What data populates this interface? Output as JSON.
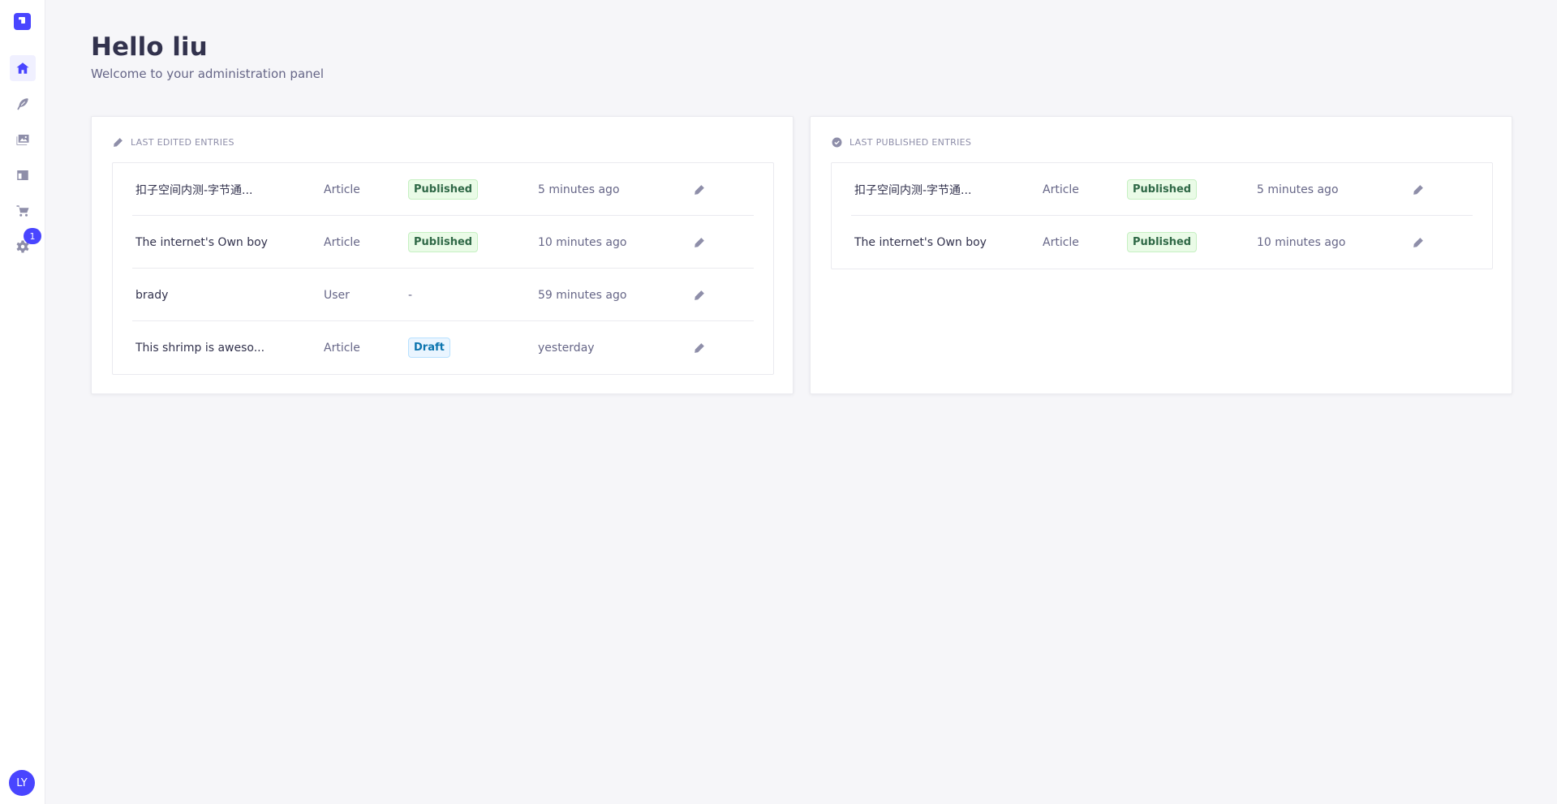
{
  "sidebar": {
    "items": [
      {
        "name": "home",
        "icon": "home-icon"
      },
      {
        "name": "content-manager",
        "icon": "feather-icon"
      },
      {
        "name": "media-library",
        "icon": "images-icon"
      },
      {
        "name": "content-type-builder",
        "icon": "layout-icon"
      },
      {
        "name": "marketplace",
        "icon": "cart-icon"
      },
      {
        "name": "settings",
        "icon": "gear-icon"
      }
    ],
    "settings_badge": "1",
    "avatar_initials": "LY"
  },
  "header": {
    "title": "Hello liu",
    "subtitle": "Welcome to your administration panel"
  },
  "last_edited": {
    "title": "LAST EDITED ENTRIES",
    "rows": [
      {
        "title": "扣子空间内测-字节通...",
        "type": "Article",
        "status": "Published",
        "time": "5 minutes ago"
      },
      {
        "title": "The internet's Own boy",
        "type": "Article",
        "status": "Published",
        "time": "10 minutes ago"
      },
      {
        "title": "brady",
        "type": "User",
        "status": "-",
        "time": "59 minutes ago"
      },
      {
        "title": "This shrimp is aweso...",
        "type": "Article",
        "status": "Draft",
        "time": "yesterday"
      }
    ]
  },
  "last_published": {
    "title": "LAST PUBLISHED ENTRIES",
    "rows": [
      {
        "title": "扣子空间内测-字节通...",
        "type": "Article",
        "status": "Published",
        "time": "5 minutes ago"
      },
      {
        "title": "The internet's Own boy",
        "type": "Article",
        "status": "Published",
        "time": "10 minutes ago"
      }
    ]
  },
  "colors": {
    "accent": "#4945ff",
    "published_bg": "#eafbe7",
    "published_text": "#2f6846",
    "draft_bg": "#eaf5ff",
    "draft_text": "#0c75af"
  }
}
